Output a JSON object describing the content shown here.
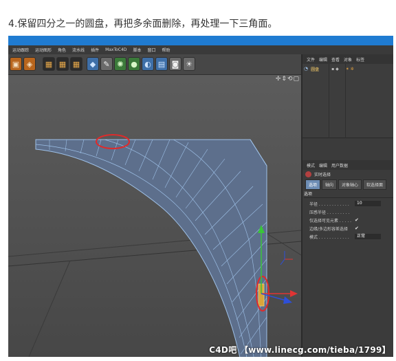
{
  "caption": "4.保留四分之一的圆盘，再把多余面删除，再处理一下三角面。",
  "menubar": [
    "运动跟踪",
    "运动图形",
    "角色",
    "流水线",
    "插件",
    "MaxToC4D",
    "脚本",
    "窗口",
    "帮助"
  ],
  "toolbar_icons": [
    "cube-icon",
    "clapper-icon",
    "clapper-icon",
    "clapper-icon",
    "cube-icon",
    "pen-icon",
    "subdivision-icon",
    "sphere-icon",
    "deformer-icon",
    "floor-icon",
    "camera-icon",
    "light-icon"
  ],
  "viewport": {
    "nav_icons": "✢⇕⟲▢"
  },
  "object_manager": {
    "menu": [
      "文件",
      "编辑",
      "查看",
      "对象",
      "标签"
    ],
    "object_name": "圆盘"
  },
  "attribute_manager": {
    "menu": [
      "模式",
      "编辑",
      "用户数据"
    ],
    "title": "实时选择",
    "tabs": [
      "选项",
      "轴向",
      "对象轴心",
      "软选择面"
    ],
    "active_tab": "选项",
    "section": "选项",
    "fields": [
      {
        "label": "半径 . . . . . . . . . . . .",
        "value": "10",
        "kind": "number"
      },
      {
        "label": "压感半径 . . . . . . . . .",
        "value": "",
        "kind": "checkbox"
      },
      {
        "label": "仅选择可见元素 . . . . .",
        "value": "✔",
        "kind": "checkbox"
      },
      {
        "label": "边缘/多边形容差选择",
        "value": "✔",
        "kind": "checkbox"
      },
      {
        "label": "模式 . . . . . . . . . . . .",
        "value": "正常",
        "kind": "select"
      }
    ]
  },
  "watermark": "C4D吧 【www.linecg.com/tieba/1799】",
  "colors": {
    "title_bar": "#1f7bd1",
    "mesh_face": "#5d6f8c",
    "mesh_edge": "#9ec1e8",
    "annotation": "#e02a2a",
    "axis_y": "#39c539",
    "axis_x": "#e03434",
    "axis_z": "#2d4fd9"
  }
}
